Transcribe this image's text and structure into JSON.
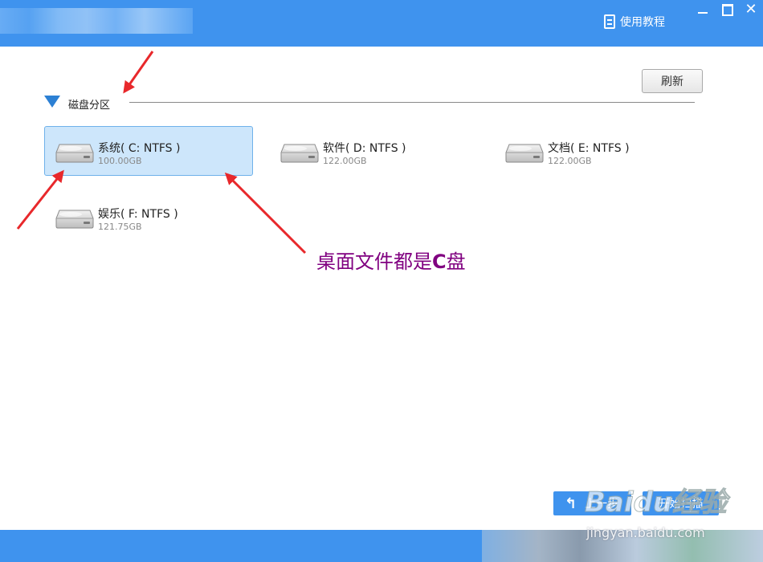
{
  "window": {
    "help_label": "使用教程",
    "help_icon": "document-icon",
    "controls": [
      "minimize-icon",
      "maximize-icon",
      "close-icon"
    ]
  },
  "toolbar": {
    "refresh_label": "刷新"
  },
  "section": {
    "title": "磁盘分区",
    "toggle_icon": "triangle-down-icon"
  },
  "drives": [
    {
      "name": "系统( C: NTFS )",
      "size": "100.00GB",
      "selected": true
    },
    {
      "name": "软件( D: NTFS )",
      "size": "122.00GB",
      "selected": false
    },
    {
      "name": "文档( E: NTFS )",
      "size": "122.00GB",
      "selected": false
    },
    {
      "name": "娱乐( F: NTFS )",
      "size": "121.75GB",
      "selected": false
    }
  ],
  "annotation": {
    "text": "桌面文件都是",
    "emphasis": "C",
    "suffix": "盘",
    "color": "#800080"
  },
  "footer": {
    "back_label": "上一步",
    "scan_label": "开始扫描"
  },
  "watermark": {
    "logo": "Baidu经验",
    "url": "jingyan.baidu.com"
  },
  "colors": {
    "accent": "#3f93ee",
    "selected_bg": "#cde6fb",
    "arrow": "#e8282b"
  }
}
